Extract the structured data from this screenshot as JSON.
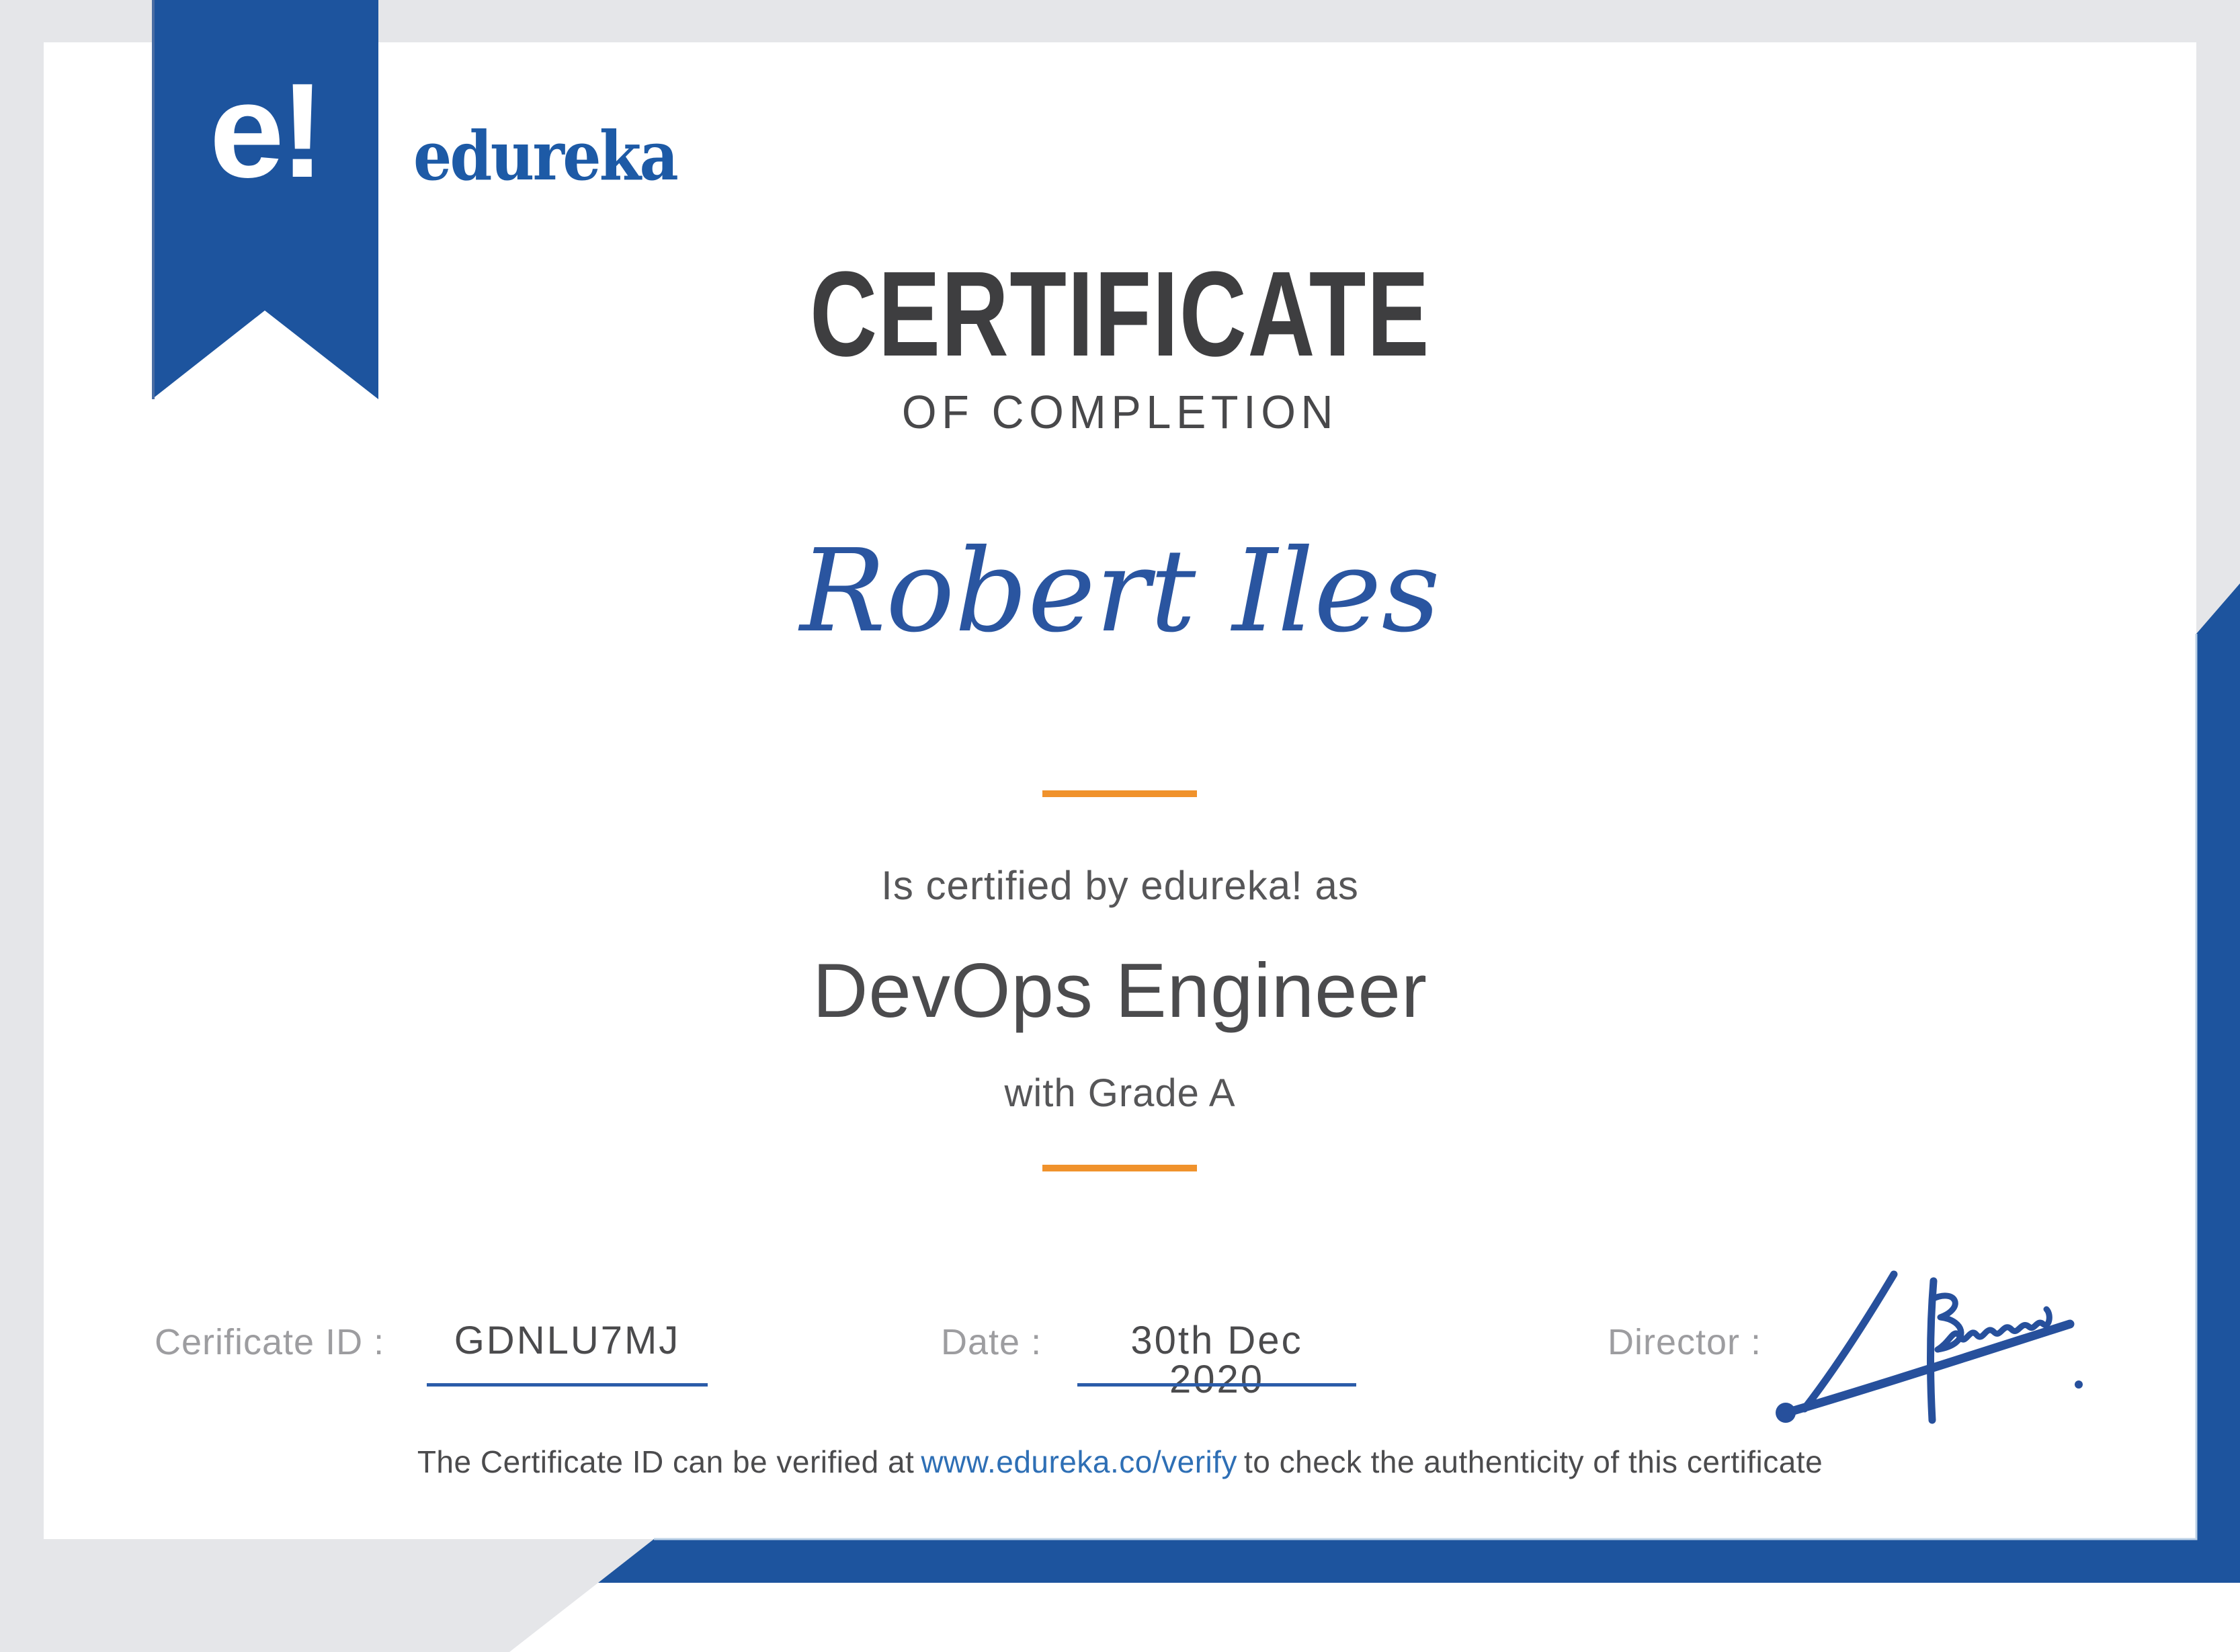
{
  "certificate": {
    "brand": {
      "logo": "e!",
      "wordmark": "edureka"
    },
    "title": "CERTIFICATE",
    "subtitle": "OF COMPLETION",
    "recipient_name": "Robert Iles",
    "certified_by_line": "Is certified by edureka! as",
    "course_title": "DevOps Engineer",
    "grade_line": "with Grade A",
    "details": {
      "certificate_id_label": "Cerificate ID :",
      "certificate_id": "GDNLU7MJ",
      "date_label": "Date :",
      "date": "30th Dec 2020",
      "director_label": "Director :"
    },
    "verification": {
      "text_before_link": "The Certificate ID can be verified at",
      "link_text": "www.edureka.co/verify",
      "text_after_link": "to check the authenticity of this certificate"
    },
    "colors": {
      "brand_blue": "#1d549e",
      "wordmark_blue": "#1d5aa6",
      "name_blue": "#2a55a0",
      "accent_orange": "#f0922c",
      "link_blue": "#2e6fb5",
      "underline_blue": "#2b5ca9",
      "signature_blue": "#27509c",
      "title_gray": "#3e3e40",
      "subtitle_gray": "#48484a",
      "body_gray": "#565658",
      "label_gray": "#9d9da0",
      "value_gray": "#4b4b4d",
      "background_gray": "#e5e6e9"
    }
  }
}
